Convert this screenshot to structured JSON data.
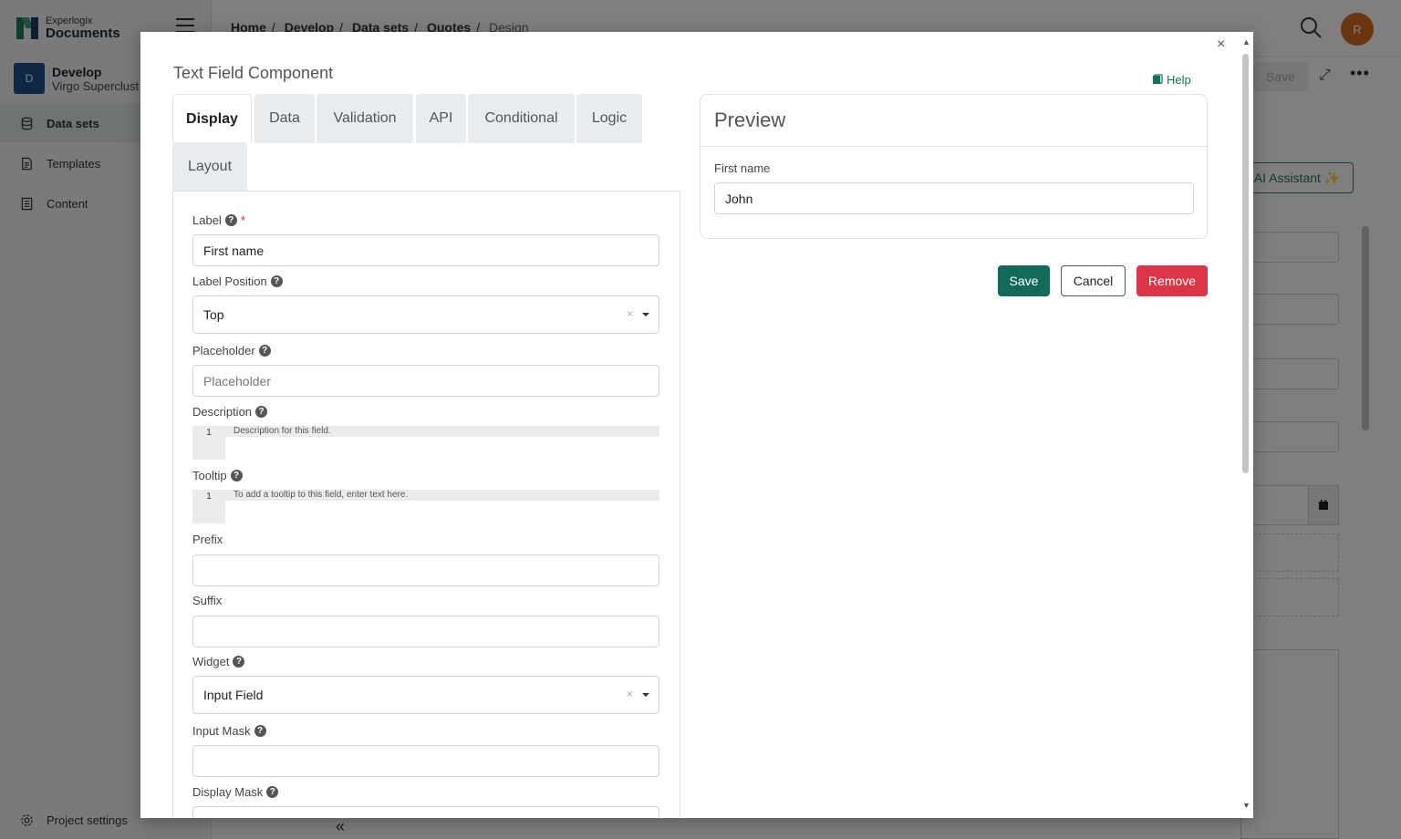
{
  "app": {
    "logo_small": "Experlogix",
    "logo_big": "Documents",
    "project_badge": "D",
    "project_name": "Develop",
    "project_sub": "Virgo Superclust",
    "nav": [
      "Data sets",
      "Templates",
      "Content"
    ],
    "project_settings": "Project settings",
    "breadcrumb": [
      "Home",
      "Develop",
      "Data sets",
      "Quotes",
      "Design"
    ],
    "avatar_initial": "R",
    "save_label": "Save",
    "ai_assistant": "AI Assistant ✨"
  },
  "modal": {
    "title": "Text Field Component",
    "help": "Help",
    "tabs": [
      "Display",
      "Data",
      "Validation",
      "API",
      "Conditional",
      "Logic",
      "Layout"
    ],
    "active_tab": "Display",
    "fields": {
      "label": {
        "label": "Label",
        "value": "First name"
      },
      "label_position": {
        "label": "Label Position",
        "value": "Top"
      },
      "placeholder": {
        "label": "Placeholder",
        "placeholder": "Placeholder"
      },
      "description": {
        "label": "Description",
        "line_no": "1",
        "hint": "Description for this field."
      },
      "tooltip": {
        "label": "Tooltip",
        "line_no": "1",
        "hint": "To add a tooltip to this field, enter text here."
      },
      "prefix": {
        "label": "Prefix",
        "value": ""
      },
      "suffix": {
        "label": "Suffix",
        "value": ""
      },
      "widget": {
        "label": "Widget",
        "value": "Input Field"
      },
      "input_mask": {
        "label": "Input Mask",
        "value": ""
      },
      "display_mask": {
        "label": "Display Mask",
        "value": ""
      }
    },
    "preview": {
      "title": "Preview",
      "field_label": "First name",
      "field_value": "John"
    },
    "buttons": {
      "save": "Save",
      "cancel": "Cancel",
      "remove": "Remove"
    }
  },
  "colors": {
    "primary": "#126b58",
    "danger": "#dc3545",
    "avatar": "#d9681e"
  }
}
